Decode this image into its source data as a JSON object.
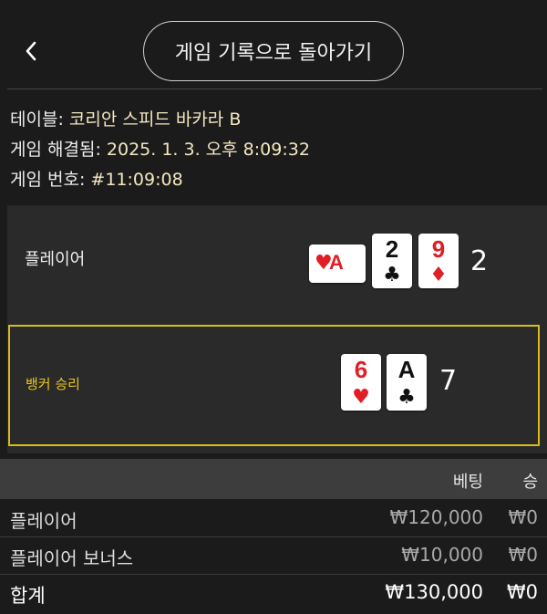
{
  "header": {
    "back_icon": "chevron-left-icon",
    "back_label": "‹",
    "title_button": "게임 기록으로 돌아가기"
  },
  "info": {
    "table_label": "테이블:",
    "table_value": "코리안 스피드 바카라 B",
    "resolved_label": "게임 해결됨:",
    "resolved_value": "2025. 1. 3. 오후 8:09:32",
    "game_no_label": "게임 번호:",
    "game_no_value": "#11:09:08"
  },
  "player": {
    "label": "플레이어",
    "cards": [
      {
        "rank": "A",
        "suit": "♥",
        "color": "red",
        "rotated": true
      },
      {
        "rank": "2",
        "suit": "♣",
        "color": "black",
        "rotated": false
      },
      {
        "rank": "9",
        "suit": "♦",
        "color": "red",
        "rotated": false
      }
    ],
    "total": "2"
  },
  "banker": {
    "label": "뱅커 승리",
    "cards": [
      {
        "rank": "6",
        "suit": "♥",
        "color": "red",
        "rotated": false
      },
      {
        "rank": "A",
        "suit": "♣",
        "color": "black",
        "rotated": false
      }
    ],
    "total": "7"
  },
  "table": {
    "headers": {
      "bet": "베팅",
      "win": "승"
    },
    "rows": [
      {
        "label": "플레이어",
        "bet": "₩120,000",
        "win": "₩0"
      },
      {
        "label": "플레이어 보너스",
        "bet": "₩10,000",
        "win": "₩0"
      },
      {
        "label": "합계",
        "bet": "₩130,000",
        "win": "₩0"
      }
    ]
  },
  "colors": {
    "background": "#1b1b1b",
    "panel": "#2a2a2a",
    "banker_accent": "#d8bc1a",
    "info_value": "#f4e7c0",
    "card_red": "#e01e25"
  }
}
